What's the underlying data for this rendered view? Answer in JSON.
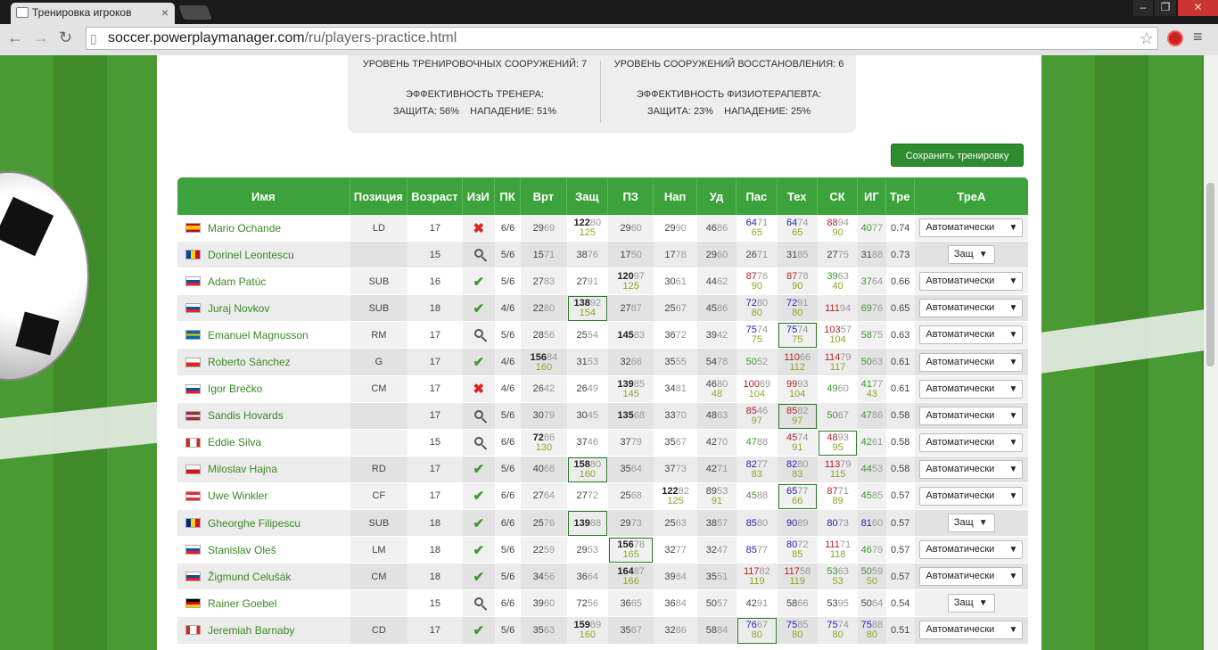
{
  "browser": {
    "tab_title": "Тренировка игроков",
    "url_host": "soccer.powerplaymanager.com",
    "url_path": "/ru/players-practice.html"
  },
  "facilities": {
    "training_level": "УРОВЕНЬ ТРЕНИРОВОЧНЫХ СООРУЖЕНИЙ: 7",
    "recovery_level": "УРОВЕНЬ СООРУЖЕНИЙ ВОССТАНОВЛЕНИЯ: 6",
    "coach_title": "ЭФФЕКТИВНОСТЬ ТРЕНЕРА:",
    "coach_values": "ЗАЩИТА: 56%    НАПАДЕНИЕ: 51%",
    "physio_title": "ЭФФЕКТИВНОСТЬ ФИЗИОТЕРАПЕВТА:",
    "physio_values": "ЗАЩИТА: 23%    НАПАДЕНИЕ: 25%"
  },
  "save_button": "Сохранить тренировку",
  "columns": [
    "Имя",
    "Позиция",
    "Возраст",
    "ИзИ",
    "ПК",
    "Врт",
    "Защ",
    "ПЗ",
    "Нап",
    "Уд",
    "Пас",
    "Тех",
    "СК",
    "ИГ",
    "Тре",
    "ТреА"
  ],
  "colors": {
    "header": "#3ca33c",
    "link": "#3a8a24",
    "blue": "#2424b4",
    "red": "#b42424",
    "green": "#3a9a2a"
  },
  "players": [
    {
      "name": "Mario Ochande",
      "flag": "ES",
      "pos": "LD",
      "age": "17",
      "izi": "x",
      "pk": "6/6",
      "stats": [
        [
          "29",
          "69",
          "",
          ""
        ],
        [
          "122",
          "80",
          "125",
          "b"
        ],
        [
          "29",
          "60",
          "",
          ""
        ],
        [
          "29",
          "90",
          "",
          ""
        ],
        [
          "46",
          "86",
          "",
          ""
        ],
        [
          "64",
          "71",
          "65",
          "u"
        ],
        [
          "64",
          "74",
          "65",
          "u"
        ],
        [
          "88",
          "94",
          "90",
          "r"
        ],
        [
          "40",
          "77",
          "",
          "g"
        ]
      ],
      "tre": "0.74",
      "trea": "Автоматически"
    },
    {
      "name": "Dorinel Leontescu",
      "flag": "MD",
      "pos": "",
      "age": "15",
      "izi": "mag",
      "pk": "5/6",
      "stats": [
        [
          "15",
          "71",
          "",
          ""
        ],
        [
          "38",
          "76",
          "",
          ""
        ],
        [
          "17",
          "50",
          "",
          ""
        ],
        [
          "17",
          "78",
          "",
          ""
        ],
        [
          "29",
          "60",
          "",
          ""
        ],
        [
          "26",
          "71",
          "",
          ""
        ],
        [
          "31",
          "85",
          "",
          ""
        ],
        [
          "27",
          "75",
          "",
          ""
        ],
        [
          "31",
          "88",
          "",
          ""
        ]
      ],
      "tre": "0.73",
      "trea": "Защ"
    },
    {
      "name": "Adam Patúc",
      "flag": "SK",
      "pos": "SUB",
      "age": "16",
      "izi": "ok",
      "pk": "5/6",
      "stats": [
        [
          "27",
          "83",
          "",
          ""
        ],
        [
          "27",
          "91",
          "",
          ""
        ],
        [
          "120",
          "97",
          "125",
          "b"
        ],
        [
          "30",
          "61",
          "",
          ""
        ],
        [
          "44",
          "62",
          "",
          ""
        ],
        [
          "87",
          "76",
          "90",
          "r"
        ],
        [
          "87",
          "78",
          "90",
          "r"
        ],
        [
          "39",
          "63",
          "40",
          "g"
        ],
        [
          "37",
          "64",
          "",
          "g"
        ]
      ],
      "tre": "0.66",
      "trea": "Автоматически"
    },
    {
      "name": "Juraj Novkov",
      "flag": "SK",
      "pos": "SUB",
      "age": "18",
      "izi": "ok",
      "pk": "4/6",
      "stats": [
        [
          "22",
          "80",
          "",
          ""
        ],
        [
          "138",
          "92",
          "154",
          "bx"
        ],
        [
          "27",
          "87",
          "",
          ""
        ],
        [
          "25",
          "67",
          "",
          ""
        ],
        [
          "45",
          "86",
          "",
          ""
        ],
        [
          "72",
          "80",
          "80",
          "u"
        ],
        [
          "72",
          "91",
          "80",
          "u"
        ],
        [
          "111",
          "94",
          "",
          "r"
        ],
        [
          "69",
          "76",
          "",
          "g"
        ]
      ],
      "tre": "0.65",
      "trea": "Автоматически"
    },
    {
      "name": "Emanuel Magnusson",
      "flag": "SE",
      "pos": "RM",
      "age": "17",
      "izi": "mag",
      "pk": "5/6",
      "stats": [
        [
          "28",
          "56",
          "",
          ""
        ],
        [
          "25",
          "54",
          "",
          ""
        ],
        [
          "145",
          "83",
          "",
          "b"
        ],
        [
          "36",
          "72",
          "",
          ""
        ],
        [
          "39",
          "42",
          "",
          ""
        ],
        [
          "75",
          "74",
          "75",
          "u"
        ],
        [
          "75",
          "74",
          "75",
          "ux"
        ],
        [
          "103",
          "57",
          "104",
          "r"
        ],
        [
          "58",
          "75",
          "",
          "g"
        ]
      ],
      "tre": "0.63",
      "trea": "Автоматически"
    },
    {
      "name": "Roberto Sánchez",
      "flag": "CL",
      "pos": "G",
      "age": "17",
      "izi": "ok",
      "pk": "4/6",
      "stats": [
        [
          "156",
          "84",
          "160",
          "b"
        ],
        [
          "31",
          "53",
          "",
          ""
        ],
        [
          "32",
          "66",
          "",
          ""
        ],
        [
          "35",
          "55",
          "",
          ""
        ],
        [
          "54",
          "78",
          "",
          ""
        ],
        [
          "50",
          "52",
          "",
          "g"
        ],
        [
          "110",
          "66",
          "112",
          "r"
        ],
        [
          "114",
          "79",
          "117",
          "r"
        ],
        [
          "50",
          "63",
          "",
          "g"
        ]
      ],
      "tre": "0.61",
      "trea": "Автоматически"
    },
    {
      "name": "Igor Brečko",
      "flag": "SI",
      "pos": "CM",
      "age": "17",
      "izi": "x",
      "pk": "4/6",
      "stats": [
        [
          "26",
          "42",
          "",
          ""
        ],
        [
          "26",
          "49",
          "",
          ""
        ],
        [
          "139",
          "85",
          "145",
          "b"
        ],
        [
          "34",
          "81",
          "",
          ""
        ],
        [
          "46",
          "80",
          "48",
          ""
        ],
        [
          "100",
          "69",
          "104",
          "r"
        ],
        [
          "99",
          "93",
          "104",
          "r"
        ],
        [
          "49",
          "60",
          "",
          "g"
        ],
        [
          "41",
          "77",
          "43",
          "g"
        ]
      ],
      "tre": "0.61",
      "trea": "Автоматически"
    },
    {
      "name": "Sandis Hovards",
      "flag": "LV",
      "pos": "",
      "age": "17",
      "izi": "mag",
      "pk": "5/6",
      "stats": [
        [
          "30",
          "79",
          "",
          ""
        ],
        [
          "30",
          "45",
          "",
          ""
        ],
        [
          "135",
          "68",
          "",
          "b"
        ],
        [
          "33",
          "70",
          "",
          ""
        ],
        [
          "48",
          "63",
          "",
          ""
        ],
        [
          "85",
          "46",
          "97",
          "r"
        ],
        [
          "85",
          "82",
          "97",
          "rx"
        ],
        [
          "50",
          "67",
          "",
          "g"
        ],
        [
          "47",
          "86",
          "",
          "g"
        ]
      ],
      "tre": "0.58",
      "trea": "Автоматически"
    },
    {
      "name": "Eddie Silva",
      "flag": "CA",
      "pos": "",
      "age": "15",
      "izi": "mag",
      "pk": "6/6",
      "stats": [
        [
          "72",
          "86",
          "130",
          "b"
        ],
        [
          "37",
          "46",
          "",
          ""
        ],
        [
          "37",
          "79",
          "",
          ""
        ],
        [
          "35",
          "67",
          "",
          ""
        ],
        [
          "42",
          "70",
          "",
          ""
        ],
        [
          "47",
          "88",
          "",
          "g"
        ],
        [
          "45",
          "74",
          "91",
          "r"
        ],
        [
          "48",
          "93",
          "95",
          "rx"
        ],
        [
          "42",
          "61",
          "",
          "g"
        ]
      ],
      "tre": "0.58",
      "trea": "Автоматически"
    },
    {
      "name": "Miloslav Hajna",
      "flag": "CZ",
      "pos": "RD",
      "age": "17",
      "izi": "ok",
      "pk": "5/6",
      "stats": [
        [
          "40",
          "68",
          "",
          ""
        ],
        [
          "158",
          "80",
          "160",
          "bx"
        ],
        [
          "35",
          "64",
          "",
          ""
        ],
        [
          "37",
          "73",
          "",
          ""
        ],
        [
          "42",
          "71",
          "",
          ""
        ],
        [
          "82",
          "77",
          "83",
          "u"
        ],
        [
          "82",
          "80",
          "83",
          "u"
        ],
        [
          "113",
          "79",
          "115",
          "r"
        ],
        [
          "44",
          "53",
          "",
          "g"
        ]
      ],
      "tre": "0.58",
      "trea": "Автоматически"
    },
    {
      "name": "Uwe Winkler",
      "flag": "AT",
      "pos": "CF",
      "age": "17",
      "izi": "ok",
      "pk": "6/6",
      "stats": [
        [
          "27",
          "64",
          "",
          ""
        ],
        [
          "27",
          "72",
          "",
          ""
        ],
        [
          "25",
          "68",
          "",
          ""
        ],
        [
          "122",
          "82",
          "125",
          "b"
        ],
        [
          "89",
          "53",
          "91",
          ""
        ],
        [
          "45",
          "88",
          "",
          "g"
        ],
        [
          "65",
          "77",
          "66",
          "ux"
        ],
        [
          "87",
          "71",
          "89",
          "r"
        ],
        [
          "45",
          "85",
          "",
          "g"
        ]
      ],
      "tre": "0.57",
      "trea": "Автоматически"
    },
    {
      "name": "Gheorghe Filipescu",
      "flag": "RO",
      "pos": "SUB",
      "age": "18",
      "izi": "ok",
      "pk": "6/6",
      "stats": [
        [
          "25",
          "76",
          "",
          ""
        ],
        [
          "139",
          "88",
          "",
          "bx"
        ],
        [
          "29",
          "73",
          "",
          ""
        ],
        [
          "25",
          "63",
          "",
          ""
        ],
        [
          "38",
          "57",
          "",
          ""
        ],
        [
          "85",
          "80",
          "",
          "u"
        ],
        [
          "90",
          "89",
          "",
          "u"
        ],
        [
          "80",
          "73",
          "",
          "u"
        ],
        [
          "81",
          "60",
          "",
          "u"
        ]
      ],
      "tre": "0.57",
      "trea": "Защ"
    },
    {
      "name": "Stanislav Oleš",
      "flag": "SK",
      "pos": "LM",
      "age": "18",
      "izi": "ok",
      "pk": "5/6",
      "stats": [
        [
          "22",
          "59",
          "",
          ""
        ],
        [
          "29",
          "53",
          "",
          ""
        ],
        [
          "156",
          "78",
          "165",
          "bx"
        ],
        [
          "32",
          "77",
          "",
          ""
        ],
        [
          "32",
          "47",
          "",
          ""
        ],
        [
          "85",
          "77",
          "",
          "u"
        ],
        [
          "80",
          "72",
          "85",
          "u"
        ],
        [
          "111",
          "71",
          "118",
          "r"
        ],
        [
          "46",
          "79",
          "",
          "g"
        ]
      ],
      "tre": "0.57",
      "trea": "Автоматически"
    },
    {
      "name": "Žigmund Celušák",
      "flag": "SK",
      "pos": "CM",
      "age": "18",
      "izi": "ok",
      "pk": "5/6",
      "stats": [
        [
          "34",
          "56",
          "",
          ""
        ],
        [
          "36",
          "64",
          "",
          ""
        ],
        [
          "164",
          "87",
          "166",
          "b"
        ],
        [
          "39",
          "84",
          "",
          ""
        ],
        [
          "35",
          "51",
          "",
          ""
        ],
        [
          "117",
          "82",
          "119",
          "r"
        ],
        [
          "117",
          "58",
          "119",
          "r"
        ],
        [
          "53",
          "63",
          "53",
          "g"
        ],
        [
          "50",
          "59",
          "50",
          "g"
        ]
      ],
      "tre": "0.57",
      "trea": "Автоматически"
    },
    {
      "name": "Rainer Goebel",
      "flag": "DE",
      "pos": "",
      "age": "15",
      "izi": "mag",
      "pk": "6/6",
      "stats": [
        [
          "39",
          "60",
          "",
          ""
        ],
        [
          "72",
          "56",
          "",
          ""
        ],
        [
          "36",
          "65",
          "",
          ""
        ],
        [
          "36",
          "84",
          "",
          ""
        ],
        [
          "50",
          "57",
          "",
          ""
        ],
        [
          "42",
          "91",
          "",
          ""
        ],
        [
          "58",
          "66",
          "",
          ""
        ],
        [
          "53",
          "95",
          "",
          ""
        ],
        [
          "50",
          "64",
          "",
          ""
        ]
      ],
      "tre": "0.54",
      "trea": "Защ"
    },
    {
      "name": "Jeremiah Barnaby",
      "flag": "CA",
      "pos": "CD",
      "age": "17",
      "izi": "ok",
      "pk": "5/6",
      "stats": [
        [
          "35",
          "63",
          "",
          ""
        ],
        [
          "159",
          "89",
          "160",
          "b"
        ],
        [
          "35",
          "67",
          "",
          ""
        ],
        [
          "32",
          "86",
          "",
          ""
        ],
        [
          "58",
          "84",
          "",
          ""
        ],
        [
          "76",
          "67",
          "80",
          "ux"
        ],
        [
          "75",
          "85",
          "80",
          "u"
        ],
        [
          "75",
          "74",
          "80",
          "u"
        ],
        [
          "75",
          "88",
          "80",
          "u"
        ]
      ],
      "tre": "0.51",
      "trea": "Автоматически"
    }
  ]
}
